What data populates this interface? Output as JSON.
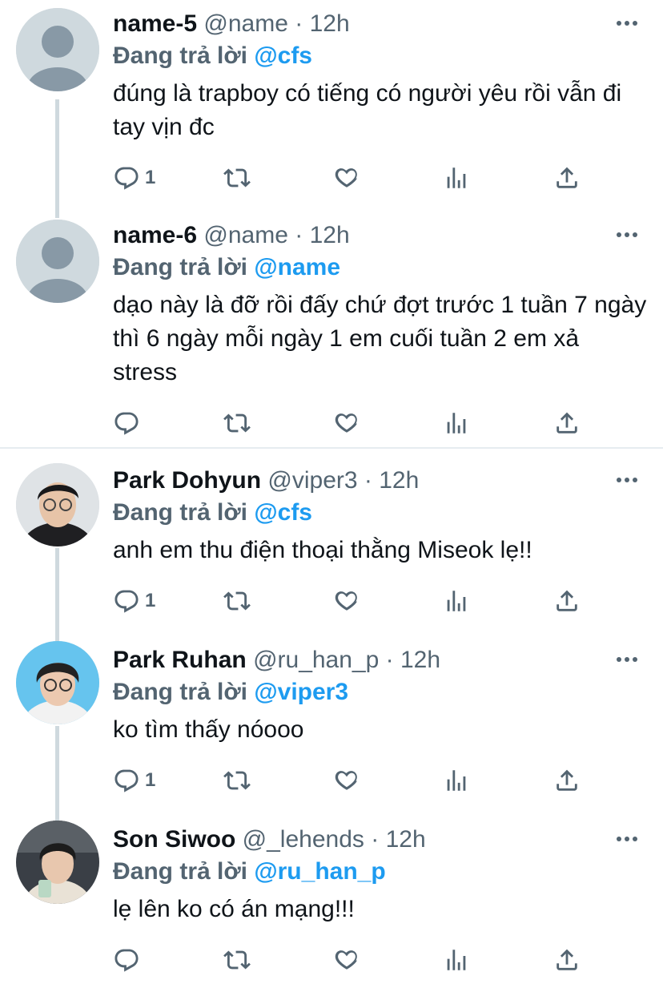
{
  "tweets": [
    {
      "name": "name-5",
      "handle": "@name",
      "dot": "·",
      "time": "12h",
      "reply_prefix": "Đang trả lời",
      "reply_to": "@cfs",
      "text": "đúng là trapboy có tiếng có người yêu rồi vẫn đi tay vịn đc",
      "reply_count": "1",
      "avatar": "default-avatar"
    },
    {
      "name": "name-6",
      "handle": "@name",
      "dot": "·",
      "time": "12h",
      "reply_prefix": "Đang trả lời",
      "reply_to": "@name",
      "text": "dạo này là đỡ rồi đấy chứ đợt trước 1 tuần 7 ngày thì 6 ngày mỗi ngày 1 em cuối tuần 2 em xả stress",
      "reply_count": "",
      "avatar": "default-avatar"
    },
    {
      "name": "Park Dohyun",
      "handle": "@viper3",
      "dot": "·",
      "time": "12h",
      "reply_prefix": "Đang trả lời",
      "reply_to": "@cfs",
      "text": "anh em thu điện thoại thằng Miseok lẹ!!",
      "reply_count": "1",
      "avatar": "photo-avatar"
    },
    {
      "name": "Park Ruhan",
      "handle": "@ru_han_p",
      "dot": "·",
      "time": "12h",
      "reply_prefix": "Đang trả lời",
      "reply_to": "@viper3",
      "text": "ko tìm thấy nóooo",
      "reply_count": "1",
      "avatar": "photo-avatar"
    },
    {
      "name": "Son Siwoo",
      "handle": "@_lehends",
      "dot": "·",
      "time": "12h",
      "reply_prefix": "Đang trả lời",
      "reply_to": "@ru_han_p",
      "text": "lẹ lên ko có án mạng!!!",
      "reply_count": "",
      "avatar": "photo-avatar"
    }
  ],
  "colors": {
    "accent": "#1d9bf0",
    "muted": "#536471",
    "text": "#0f1419",
    "thread_line": "#cfd9de"
  }
}
